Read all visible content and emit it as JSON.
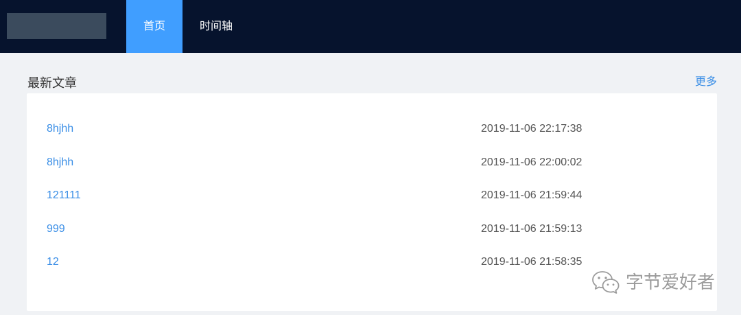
{
  "nav": {
    "tabs": [
      {
        "label": "首页",
        "active": true
      },
      {
        "label": "时间轴",
        "active": false
      }
    ]
  },
  "section": {
    "title": "最新文章",
    "more_label": "更多"
  },
  "articles": [
    {
      "title": "8hjhh",
      "date": "2019-11-06 22:17:38"
    },
    {
      "title": "8hjhh",
      "date": "2019-11-06 22:00:02"
    },
    {
      "title": "121111",
      "date": "2019-11-06 21:59:44"
    },
    {
      "title": "999",
      "date": "2019-11-06 21:59:13"
    },
    {
      "title": "12",
      "date": "2019-11-06 21:58:35"
    }
  ],
  "watermark": {
    "icon": "wechat-icon",
    "text": "字节爱好者"
  },
  "colors": {
    "nav_bg": "#06132d",
    "accent": "#409eff",
    "link": "#3a8ee6",
    "page_bg": "#f0f2f5",
    "card_bg": "#ffffff"
  }
}
